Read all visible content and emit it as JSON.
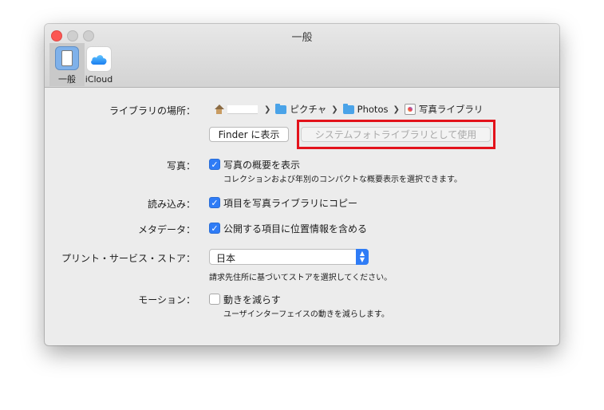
{
  "window": {
    "title": "一般"
  },
  "tabs": [
    {
      "label": "一般",
      "icon": "general-switch-icon",
      "selected": true
    },
    {
      "label": "iCloud",
      "icon": "icloud-icon",
      "selected": false
    }
  ],
  "library": {
    "label": "ライブラリの場所：",
    "path": [
      "ピクチャ",
      "Photos",
      "写真ライブラリ"
    ],
    "finder_button": "Finder に表示",
    "system_button": "システムフォトライブラリとして使用"
  },
  "photos": {
    "label": "写真：",
    "checkbox": "写真の概要を表示",
    "checked": true,
    "description": "コレクションおよび年別のコンパクトな概要表示を選択できます。"
  },
  "import": {
    "label": "読み込み：",
    "checkbox": "項目を写真ライブラリにコピー",
    "checked": true
  },
  "metadata": {
    "label": "メタデータ：",
    "checkbox": "公開する項目に位置情報を含める",
    "checked": true
  },
  "print": {
    "label": "プリント・サービス・ストア：",
    "selected": "日本",
    "description": "請求先住所に基づいてストアを選択してください。"
  },
  "motion": {
    "label": "モーション：",
    "checkbox": "動きを減らす",
    "checked": false,
    "description": "ユーザインターフェイスの動きを減らします。"
  },
  "colors": {
    "accent": "#2f7cf6",
    "highlight": "#e3121b"
  }
}
